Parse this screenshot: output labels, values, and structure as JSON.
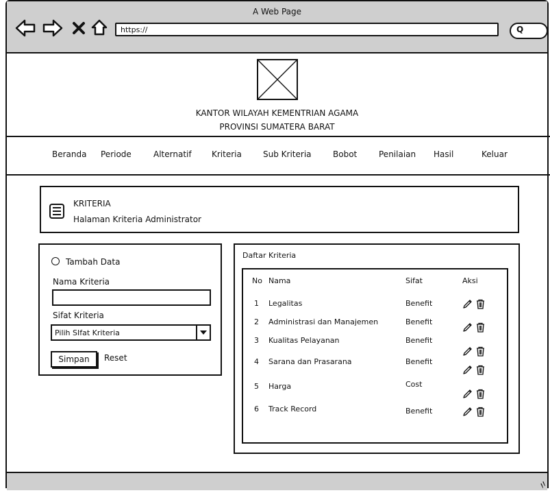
{
  "window": {
    "title": "A Web Page",
    "url": "https://"
  },
  "header": {
    "line1": "KANTOR WILAYAH KEMENTRIAN AGAMA",
    "line2": "PROVINSI SUMATERA BARAT"
  },
  "menu": [
    "Beranda",
    "Periode",
    "Alternatif",
    "Kriteria",
    "Sub Kriteria",
    "Bobot",
    "Penilaian",
    "Hasil",
    "Keluar"
  ],
  "page": {
    "title": "KRITERIA",
    "subtitle": "Halaman Kriteria Administrator"
  },
  "form": {
    "radio_label": "Tambah Data",
    "name_label": "Nama Kriteria",
    "name_value": "",
    "type_label": "Sifat Kriteria",
    "type_selected": "Pilih SIfat Kriteria",
    "save_label": "Simpan",
    "reset_label": "Reset"
  },
  "list": {
    "title": "Daftar Kriteria",
    "columns": [
      "No",
      "Nama",
      "Sifat",
      "Aksi"
    ],
    "rows": [
      {
        "no": "1",
        "name": "Legalitas",
        "type": "Benefit"
      },
      {
        "no": "2",
        "name": "Administrasi dan Manajemen",
        "type": "Benefit"
      },
      {
        "no": "3",
        "name": "Kualitas Pelayanan",
        "type": "Benefit"
      },
      {
        "no": "4",
        "name": "Sarana dan Prasarana",
        "type": "Benefit"
      },
      {
        "no": "5",
        "name": "Harga",
        "type": "Cost"
      },
      {
        "no": "6",
        "name": "Track Record",
        "type": "Benefit"
      }
    ]
  },
  "icons": {
    "back": "back-arrow-icon",
    "forward": "forward-arrow-icon",
    "stop": "close-icon",
    "home": "home-icon",
    "search": "search-icon",
    "page": "list-icon",
    "edit": "pencil-icon",
    "delete": "trash-icon"
  }
}
